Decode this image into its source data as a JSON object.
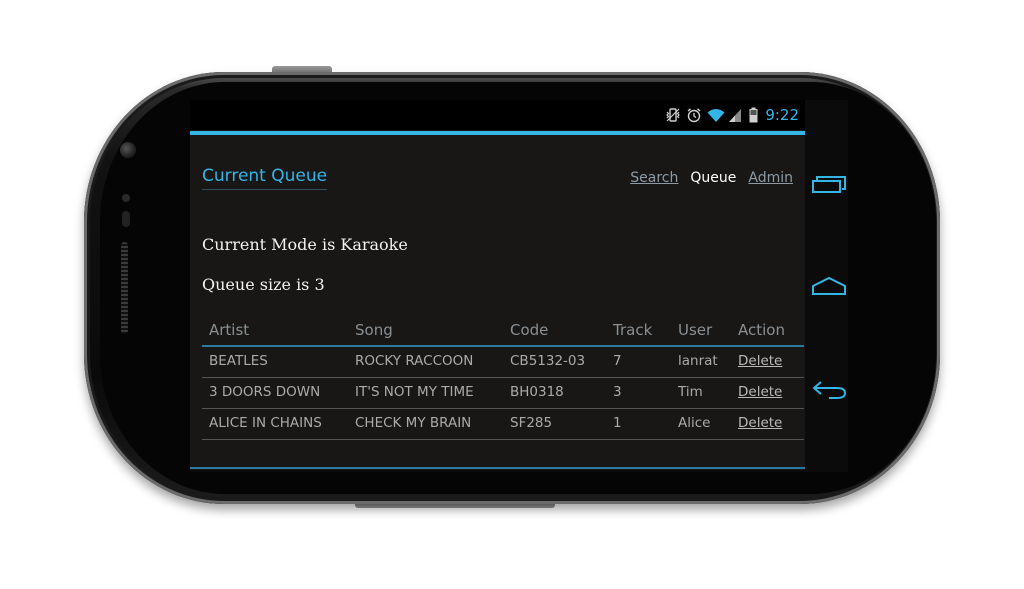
{
  "status_bar": {
    "time": "9:22",
    "icons": [
      "vibrate-icon",
      "alarm-icon",
      "wifi-icon",
      "signal-icon",
      "battery-icon"
    ],
    "accent": "#33b5e5"
  },
  "header": {
    "title": "Current Queue",
    "nav": [
      {
        "label": "Search"
      },
      {
        "label": "Queue"
      },
      {
        "label": "Admin"
      }
    ]
  },
  "info": {
    "mode": "Current Mode is Karaoke",
    "queue_size": "Queue size is 3"
  },
  "table": {
    "columns": [
      "Artist",
      "Song",
      "Code",
      "Track",
      "User",
      "Action"
    ],
    "rows": [
      {
        "artist": "BEATLES",
        "song": "ROCKY RACCOON",
        "code": "CB5132-03",
        "track": "7",
        "user": "lanrat",
        "action": "Delete"
      },
      {
        "artist": "3 DOORS DOWN",
        "song": "IT'S NOT MY TIME",
        "code": "BH0318",
        "track": "3",
        "user": "Tim",
        "action": "Delete"
      },
      {
        "artist": "ALICE IN CHAINS",
        "song": "CHECK MY BRAIN",
        "code": "SF285",
        "track": "1",
        "user": "Alice",
        "action": "Delete"
      }
    ]
  },
  "system_nav": {
    "buttons": [
      "recent-apps-icon",
      "home-icon",
      "back-icon"
    ]
  }
}
